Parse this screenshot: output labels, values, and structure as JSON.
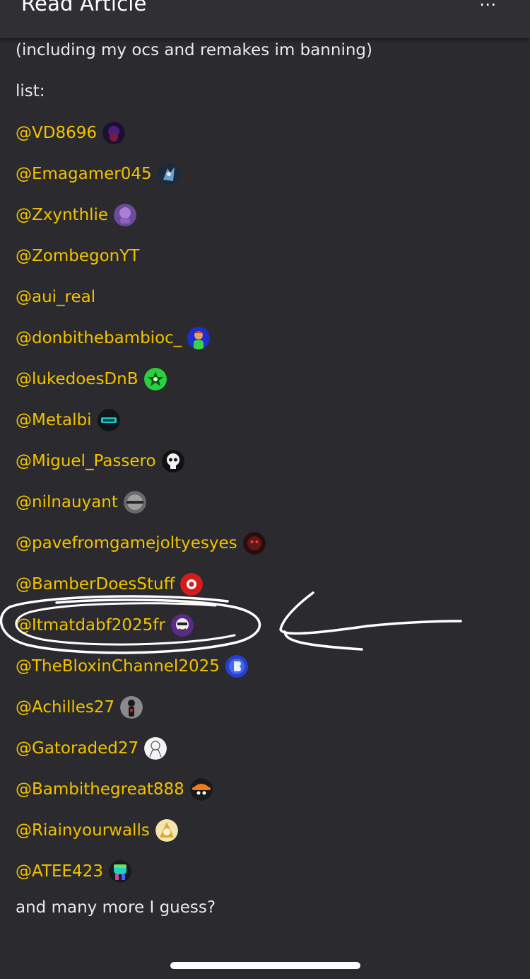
{
  "header": {
    "title": "Read Article",
    "more_icon": "⋯"
  },
  "article": {
    "intro": "(including my ocs and remakes im banning)",
    "list_label": "list:",
    "mentions": [
      {
        "handle": "@VD8696",
        "avatar": "dark-purple-avatar-icon"
      },
      {
        "handle": "@Emagamer045",
        "avatar": "blue-character-avatar-icon"
      },
      {
        "handle": "@Zxynthlie",
        "avatar": "purple-character-avatar-icon"
      },
      {
        "handle": "@ZombegonYT"
      },
      {
        "handle": "@aui_real"
      },
      {
        "handle": "@donbithebambioc_",
        "avatar": "blue-green-character-avatar-icon"
      },
      {
        "handle": "@lukedoesDnB",
        "avatar": "green-star-avatar-icon"
      },
      {
        "handle": "@Metalbi",
        "avatar": "cyan-logo-avatar-icon"
      },
      {
        "handle": "@Miguel_Passero",
        "avatar": "skull-avatar-icon"
      },
      {
        "handle": "@nilnauyant",
        "avatar": "gray-ball-avatar-icon"
      },
      {
        "handle": "@pavefromgamejoltyesyes",
        "avatar": "dark-red-face-avatar-icon"
      },
      {
        "handle": "@BamberDoesStuff",
        "avatar": "red-avatar-icon"
      },
      {
        "handle": "@Itmatdabf2025fr",
        "avatar": "white-character-avatar-icon"
      },
      {
        "handle": "@TheBloxinChannel2025",
        "avatar": "blue-logo-avatar-icon"
      },
      {
        "handle": "@Achilles27",
        "avatar": "gray-figure-avatar-icon"
      },
      {
        "handle": "@Gatoraded27",
        "avatar": "white-sketch-avatar-icon"
      },
      {
        "handle": "@Bambithegreat888",
        "avatar": "orange-hat-avatar-icon"
      },
      {
        "handle": "@Riainyourwalls",
        "avatar": "yellow-character-avatar-icon"
      },
      {
        "handle": "@ATEE423",
        "avatar": "rainbow-character-avatar-icon"
      }
    ],
    "outro": "and many more I guess?"
  },
  "annotation": {
    "circled_handle": "@Itmatdabf2025fr",
    "stroke_color": "#ffffff"
  },
  "colors": {
    "background": "#2b2b2f",
    "header": "#303034",
    "mention": "#f2c200",
    "text": "#e9e9ea"
  }
}
